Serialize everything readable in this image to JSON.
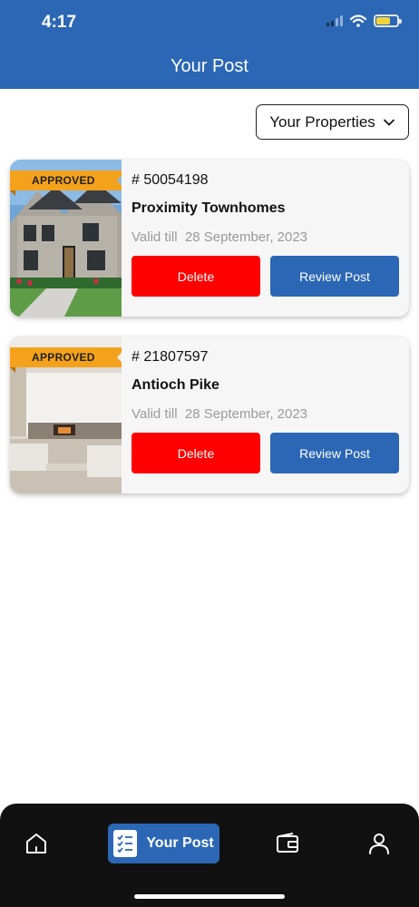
{
  "status_bar": {
    "time": "4:17"
  },
  "header": {
    "title": "Your Post"
  },
  "filter": {
    "label": "Your Properties"
  },
  "cards": [
    {
      "badge": "APPROVED",
      "id": "# 50054198",
      "name": "Proximity Townhomes",
      "valid_label": "Valid till",
      "valid_date": "28 September, 2023",
      "delete_label": "Delete",
      "review_label": "Review Post",
      "image": "house-exterior"
    },
    {
      "badge": "APPROVED",
      "id": "# 21807597",
      "name": "Antioch Pike",
      "valid_label": "Valid till",
      "valid_date": "28 September, 2023",
      "delete_label": "Delete",
      "review_label": "Review Post",
      "image": "living-room-interior"
    }
  ],
  "bottom_nav": {
    "items": [
      {
        "icon": "home-icon"
      },
      {
        "icon": "clipboard-list-icon",
        "label": "Your Post"
      },
      {
        "icon": "wallet-icon"
      },
      {
        "icon": "user-icon"
      }
    ]
  },
  "colors": {
    "primary": "#2b67b4",
    "delete": "#fe0000",
    "badge": "#f4a21c",
    "nav_background": "#111111"
  }
}
